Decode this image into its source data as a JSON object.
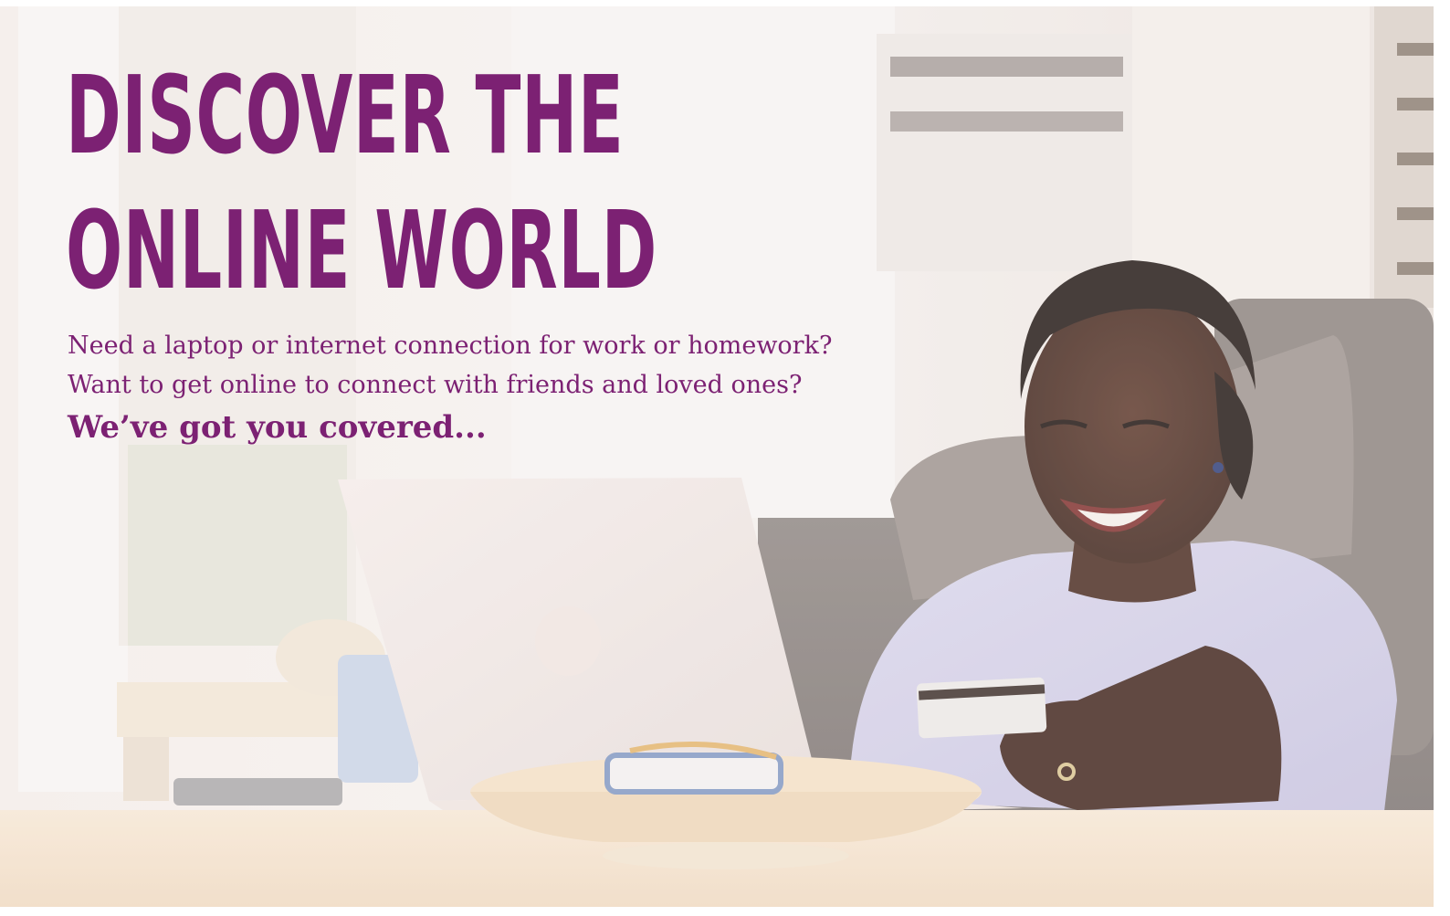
{
  "headline": {
    "line1": "DISCOVER THE",
    "line2": "ONLINE WORLD"
  },
  "body": {
    "line1": "Need a laptop or internet connection for work or homework?",
    "line2": "Want to get online to connect with friends and loved ones?"
  },
  "tagline": "We’ve got you covered...",
  "colors": {
    "brand_purple": "#7c2173",
    "background": "#ffffff"
  }
}
